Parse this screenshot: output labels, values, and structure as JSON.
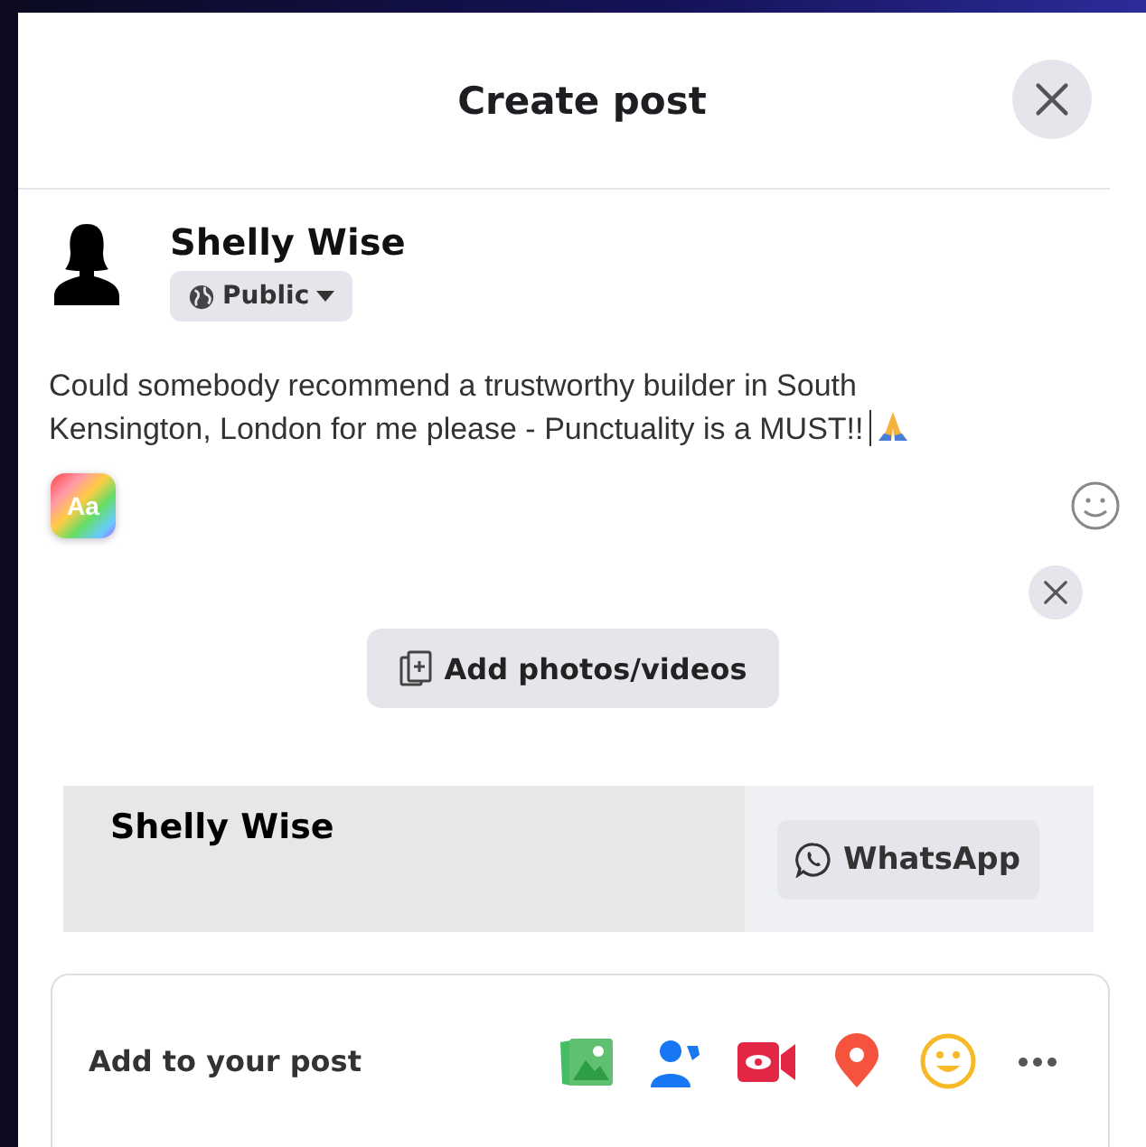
{
  "dialog": {
    "title": "Create post"
  },
  "author": {
    "name": "Shelly Wise",
    "audience": "Public"
  },
  "post": {
    "text": "Could somebody recommend a trustworthy builder in South Kensington, London for me please - Punctuality is a MUST!!",
    "style_button": "Aa"
  },
  "attachment": {
    "button": "Add photos/videos"
  },
  "share_card": {
    "name": "Shelly Wise",
    "button": "WhatsApp"
  },
  "add_to_post": {
    "label": "Add to your post",
    "tools": [
      {
        "kind": "photo"
      },
      {
        "kind": "tag"
      },
      {
        "kind": "video"
      },
      {
        "kind": "location"
      },
      {
        "kind": "feeling"
      },
      {
        "kind": "more"
      }
    ]
  }
}
